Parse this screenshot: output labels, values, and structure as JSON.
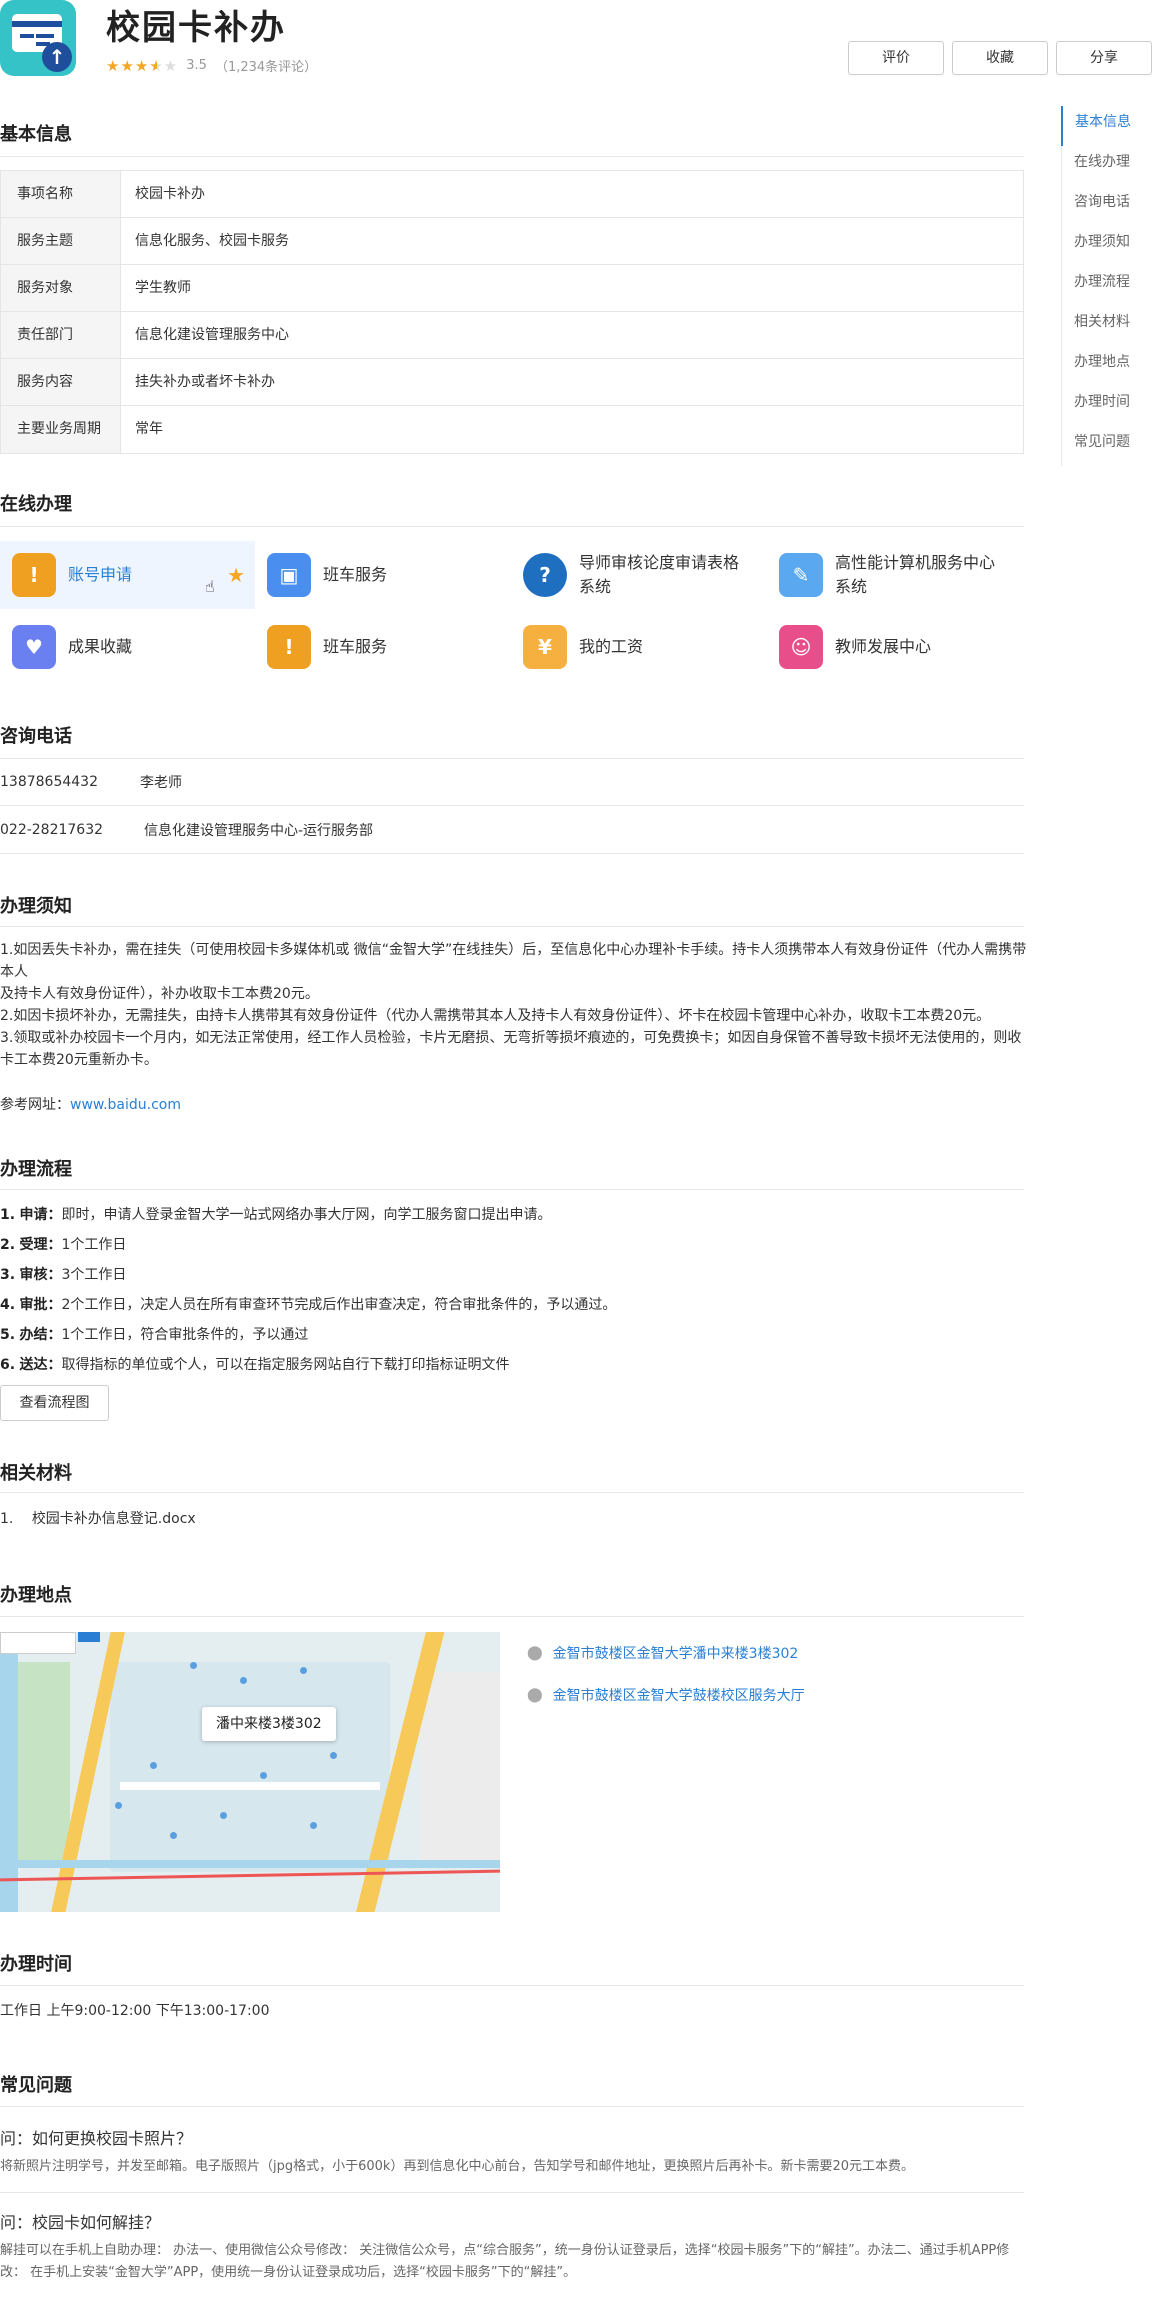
{
  "header": {
    "title": "校园卡补办",
    "rating": {
      "value": 3.5,
      "max": 5,
      "score_text": "3.5",
      "review_text": "（1,234条评论）"
    },
    "buttons": {
      "rate": "评价",
      "favorite": "收藏",
      "share": "分享"
    }
  },
  "side_nav": [
    "基本信息",
    "在线办理",
    "咨询电话",
    "办理须知",
    "办理流程",
    "相关材料",
    "办理地点",
    "办理时间",
    "常见问题"
  ],
  "basic_info": {
    "title": "基本信息",
    "rows": [
      {
        "k": "事项名称",
        "v": "校园卡补办"
      },
      {
        "k": "服务主题",
        "v": "信息化服务、校园卡服务"
      },
      {
        "k": "服务对象",
        "v": "学生教师"
      },
      {
        "k": "责任部门",
        "v": "信息化建设管理服务中心"
      },
      {
        "k": "服务内容",
        "v": "挂失补办或者坏卡补办"
      },
      {
        "k": "主要业务周期",
        "v": "常年"
      }
    ]
  },
  "online": {
    "title": "在线办理",
    "services": [
      {
        "label": "账号申请",
        "icon": "account-icon",
        "color": "#f0a020"
      },
      {
        "label": "班车服务",
        "icon": "bus-icon",
        "color": "#4a8ff0"
      },
      {
        "label": "导师审核论度审请表格系统",
        "icon": "help-icon",
        "color": "#1e6fc0"
      },
      {
        "label": "高性能计算机服务中心系统",
        "icon": "edit-icon",
        "color": "#5aa8f0"
      },
      {
        "label": "成果收藏",
        "icon": "heart-icon",
        "color": "#6a7ff0"
      },
      {
        "label": "班车服务",
        "icon": "alarm-icon",
        "color": "#f0a020"
      },
      {
        "label": "我的工资",
        "icon": "coin-icon",
        "color": "#f5b040"
      },
      {
        "label": "教师发展中心",
        "icon": "teacher-icon",
        "color": "#e84f8a"
      }
    ]
  },
  "phone": {
    "title": "咨询电话",
    "rows": [
      {
        "num": "13878654432",
        "name": "李老师"
      },
      {
        "num": "022-28217632",
        "name": "信息化建设管理服务中心-运行服务部"
      }
    ]
  },
  "notice": {
    "title": "办理须知",
    "lines": [
      "1.如因丢失卡补办，需在挂失（可使用校园卡多媒体机或 微信“金智大学”在线挂失）后，至信息化中心办理补卡手续。持卡人须携带本人有效身份证件（代办人需携带本人",
      "及持卡人有效身份证件），补办收取卡工本费20元。",
      "2.如因卡损坏补办，无需挂失，由持卡人携带其有效身份证件（代办人需携带其本人及持卡人有效身份证件）、坏卡在校园卡管理中心补办，收取卡工本费20元。",
      "3.领取或补办校园卡一个月内，如无法正常使用，经工作人员检验，卡片无磨损、无弯折等损坏痕迹的，可免费换卡；如因自身保管不善导致卡损坏无法使用的，则收卡工本费20元重新办卡。"
    ],
    "ref_label": "参考网址：",
    "ref_link": "www.baidu.com"
  },
  "process": {
    "title": "办理流程",
    "steps": [
      {
        "n": "1.",
        "name": "申请：",
        "text": "即时，申请人登录金智大学一站式网络办事大厅网，向学工服务窗口提出申请。"
      },
      {
        "n": "2.",
        "name": "受理：",
        "text": "1个工作日"
      },
      {
        "n": "3.",
        "name": "审核：",
        "text": "3个工作日"
      },
      {
        "n": "4.",
        "name": "审批：",
        "text": "2个工作日，决定人员在所有审查环节完成后作出审查决定，符合审批条件的，予以通过。"
      },
      {
        "n": "5.",
        "name": "办结：",
        "text": "1个工作日，符合审批条件的，予以通过"
      },
      {
        "n": "6.",
        "name": "送达：",
        "text": "取得指标的单位或个人，可以在指定服务网站自行下载打印指标证明文件"
      }
    ],
    "flow_button": "查看流程图"
  },
  "materials": {
    "title": "相关材料",
    "items": [
      {
        "idx": "1.",
        "name": "校园卡补办信息登记.docx"
      }
    ]
  },
  "location": {
    "title": "办理地点",
    "map_label": "潘中来楼3楼302",
    "addresses": [
      "金智市鼓楼区金智大学潘中来楼3楼302",
      "金智市鼓楼区金智大学鼓楼校区服务大厅"
    ]
  },
  "hours": {
    "title": "办理时间",
    "text": "工作日 上午9:00-12:00 下午13:00-17:00"
  },
  "faq": {
    "title": "常见问题",
    "items": [
      {
        "q": "问：如何更换校园卡照片？",
        "a": "将新照片注明学号，并发至邮箱。电子版照片（jpg格式，小于600k）再到信息化中心前台，告知学号和邮件地址，更换照片后再补卡。新卡需要20元工本费。"
      },
      {
        "q": "问：校园卡如何解挂？",
        "a": "解挂可以在手机上自助办理： 办法一、使用微信公众号修改： 关注微信公众号，点“综合服务”，统一身份认证登录后，选择“校园卡服务”下的“解挂”。办法二、通过手机APP修改： 在手机上安装“金智大学”APP，使用统一身份认证登录成功后，选择“校园卡服务”下的“解挂”。"
      }
    ]
  }
}
